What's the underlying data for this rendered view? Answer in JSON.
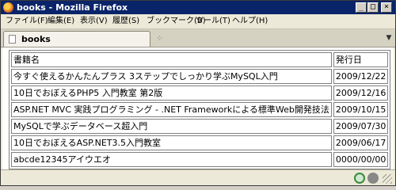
{
  "window": {
    "title": "books - Mozilla Firefox",
    "controls": {
      "minimize": "_",
      "maximize": "□",
      "close": "×"
    }
  },
  "menu": [
    {
      "label": "ファイル(F)"
    },
    {
      "label": "編集(E)"
    },
    {
      "label": "表示(V)"
    },
    {
      "label": "履歴(S)"
    },
    {
      "label": "ブックマーク(B)"
    },
    {
      "label": "ツール(T)"
    },
    {
      "label": "ヘルプ(H)"
    }
  ],
  "tabs": [
    {
      "label": "books",
      "close_glyph": "⁘"
    }
  ],
  "table": {
    "headers": [
      "書籍名",
      "発行日"
    ],
    "rows": [
      [
        "今すぐ使えるかんたんプラス 3ステップでしっかり学ぶMySQL入門",
        "2009/12/22"
      ],
      [
        "10日でおぼえるPHP5 入門教室 第2版",
        "2009/12/16"
      ],
      [
        "ASP.NET MVC 実践プログラミング - .NET Frameworkによる標準Web開発技法",
        "2009/10/15"
      ],
      [
        "MySQLで学ぶデータベース超入門",
        "2009/07/30"
      ],
      [
        "10日でおぼえるASP.NET3.5入門教室",
        "2009/06/17"
      ],
      [
        "abcde12345アイウエオ",
        "0000/00/00"
      ]
    ]
  },
  "icons": {
    "app": "firefox-icon",
    "tab": "page-icon",
    "status": [
      "connection-icon",
      "addon-icon"
    ]
  }
}
